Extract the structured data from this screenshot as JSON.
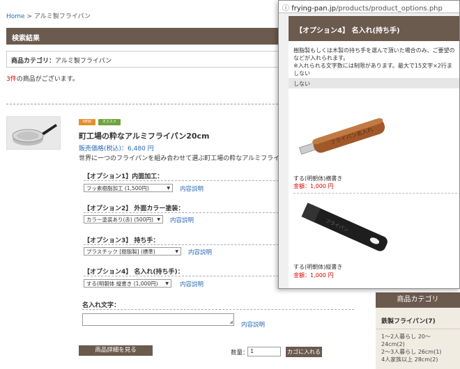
{
  "breadcrumb": {
    "home": "Home",
    "sep": ">",
    "current": "アルミ製フライパン"
  },
  "search": {
    "title": "検索結果",
    "category_label": "商品カテゴリ：",
    "category_value": "アルミ製フライパン",
    "count_num": "3件",
    "count_rest": "の商品がございます。"
  },
  "product": {
    "badge_new": "NEW",
    "badge_rec": "オススメ",
    "name": "町工場の粋なアルミフライパン20cm",
    "price_label": "販売価格(税込)：",
    "price_value": "6,480 円",
    "desc": "世界に一つのフライパンを組み合わせて選ぶ町工場の粋なアルミフライパン"
  },
  "options": [
    {
      "label": "【オプション1】内面加工：",
      "value": "フッ素樹脂加工 (1,500円)",
      "link": "内容説明"
    },
    {
      "label": "【オプション2】 外面カラー塗装：",
      "value": "カラー塗装あり(赤) (500円)",
      "link": "内容説明"
    },
    {
      "label": "【オプション3】 持ち手：",
      "value": "プラスチック [樹脂製] (標準)",
      "link": "内容説明"
    },
    {
      "label": "【オプション4】 名入れ(持ち手)：",
      "value": "する(明朝体 縦書き (1,000円)",
      "link": "内容説明"
    }
  ],
  "engrave": {
    "label": "名入れ文字：",
    "link": "内容説明"
  },
  "actions": {
    "detail_button": "商品詳細を見る",
    "qty_label": "数量：",
    "qty_value": "1",
    "cart_button": "カゴに入れる"
  },
  "sidebar": {
    "title": "商品カテゴリ",
    "category": "鉄製フライパン(7)",
    "items": [
      "1〜2人暮らし 20〜",
      "24cm(2)",
      "2〜3人暮らし 26cm(1)",
      "4人家族以上 28cm(2)"
    ]
  },
  "popup": {
    "url_host": "frying-pan.jp",
    "url_path": "/products/product_options.php",
    "title": "【オプション4】 名入れ(持ち手)",
    "desc_lines": [
      "樹脂製もしくは木製の持ち手を選んで頂いた場合のみ、ご要望の",
      "などが入れられます。",
      "※入れられる文字数には制限があります。最大で15文字×2行ま",
      "しない"
    ],
    "none_label": "しない",
    "items": [
      {
        "caption": "する(明朝体)横書き",
        "price": "金額：1,000 円"
      },
      {
        "caption": "する(明朝体)縦書き",
        "price": "金額：1,000 円"
      }
    ]
  },
  "colors": {
    "brand": "#6b5a4e",
    "link": "#2a6ab5",
    "price_red": "#dd0000",
    "sidebar_bg": "#f1ece2"
  }
}
